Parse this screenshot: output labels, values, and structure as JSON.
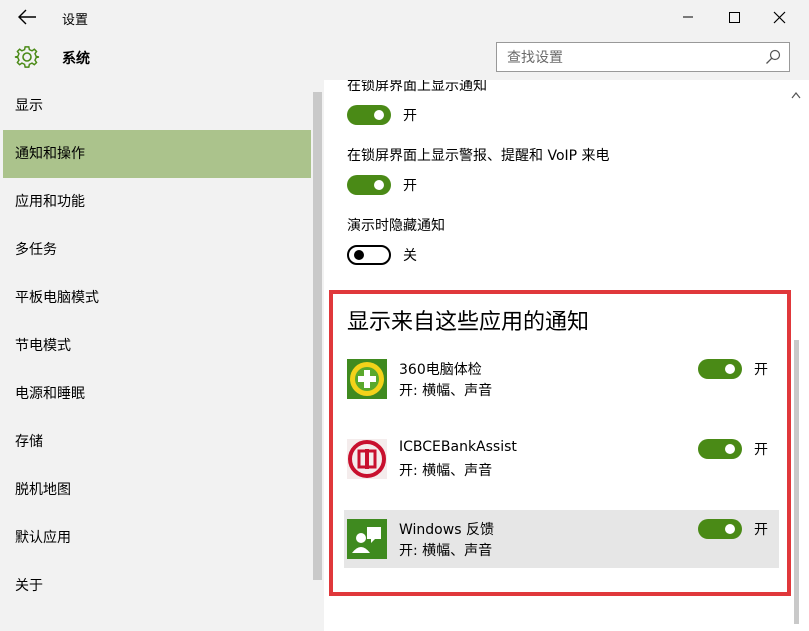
{
  "window": {
    "title": "设置",
    "colors": {
      "accent_toggle": "#4a8a16",
      "active_nav": "#abc38c",
      "highlight_border": "#e0383b",
      "chrome_bg": "#f2f2f2"
    }
  },
  "header": {
    "section_title": "系统",
    "search_placeholder": "查找设置",
    "search_value": ""
  },
  "sidebar": {
    "items": [
      {
        "label": "显示",
        "active": false
      },
      {
        "label": "通知和操作",
        "active": true
      },
      {
        "label": "应用和功能",
        "active": false
      },
      {
        "label": "多任务",
        "active": false
      },
      {
        "label": "平板电脑模式",
        "active": false
      },
      {
        "label": "节电模式",
        "active": false
      },
      {
        "label": "电源和睡眠",
        "active": false
      },
      {
        "label": "存储",
        "active": false
      },
      {
        "label": "脱机地图",
        "active": false
      },
      {
        "label": "默认应用",
        "active": false
      },
      {
        "label": "关于",
        "active": false
      }
    ]
  },
  "settings": [
    {
      "label": "在锁屏界面上显示通知",
      "state": "开",
      "on": true
    },
    {
      "label": "在锁屏界面上显示警报、提醒和 VoIP 来电",
      "state": "开",
      "on": true
    },
    {
      "label": "演示时隐藏通知",
      "state": "关",
      "on": false
    }
  ],
  "apps_section": {
    "heading": "显示来自这些应用的通知",
    "apps": [
      {
        "name": "360电脑体检",
        "detail": "开: 横幅、声音",
        "state": "开",
        "on": true,
        "icon": "360-check-icon"
      },
      {
        "name": "ICBCEBankAssist",
        "detail": "开: 横幅、声音",
        "state": "开",
        "on": true,
        "icon": "icbc-icon"
      },
      {
        "name": "Windows 反馈",
        "detail": "开: 横幅、声音",
        "state": "开",
        "on": true,
        "icon": "windows-feedback-icon"
      }
    ]
  }
}
